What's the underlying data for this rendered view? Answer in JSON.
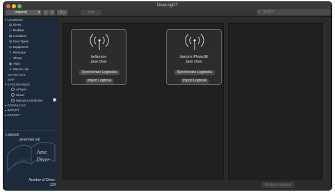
{
  "window": {
    "title": "DiveLogDT"
  },
  "toolbar": {
    "units_value": "Imperial",
    "edit_label": "Edit",
    "search_placeholder": "Search"
  },
  "sidebar": {
    "logbook_header": "LOGBOOK",
    "items": [
      {
        "label": "Dives",
        "icon": "dives-icon"
      },
      {
        "label": "Buddies",
        "icon": "buddies-icon"
      },
      {
        "label": "Locations",
        "icon": "locations-icon"
      },
      {
        "label": "Dive Types",
        "icon": "dive-types-icon"
      },
      {
        "label": "Equipment",
        "icon": "equipment-icon"
      },
      {
        "label": "Personal",
        "icon": "personal-icon"
      },
      {
        "label": "Shops",
        "icon": "shops-icon"
      },
      {
        "label": "Trips",
        "icon": "trips-icon"
      },
      {
        "label": "Marine Life",
        "icon": "marine-life-icon"
      }
    ],
    "statistics": "STATISTICS",
    "map": "MAP",
    "synchronize_header": "SYNCHRONIZE",
    "sync_items": [
      "AirSync",
      "Cloud",
      "Manual Connection"
    ],
    "download": "DOWNLOAD",
    "import": "IMPORT",
    "export": "EXPORT",
    "footer": {
      "logbook_label": "Logbook:",
      "logbook_file": "JaneDiver.sql",
      "book_text_1": "Jane",
      "book_text_2": "Diver",
      "dives_label": "Number of Dives:",
      "dives_count": "129"
    }
  },
  "devices": [
    {
      "name": "bellamore",
      "owner": "Jane Diver",
      "sync_label": "Synchronize Logbooks",
      "import_label": "Import Logbook"
    },
    {
      "name": "Janice's iPhoneSE",
      "owner": "Jane Diver",
      "sync_label": "Synchronize Logbooks",
      "import_label": "Import Logbook"
    }
  ],
  "restore_label": "Restore Logbook",
  "colors": {
    "sidebar_bg": "#1d2a3b",
    "window_bg": "#2a2a2b",
    "close": "#ec5f56",
    "minimize": "#f4bd3d",
    "maximize": "#5fc24c"
  }
}
